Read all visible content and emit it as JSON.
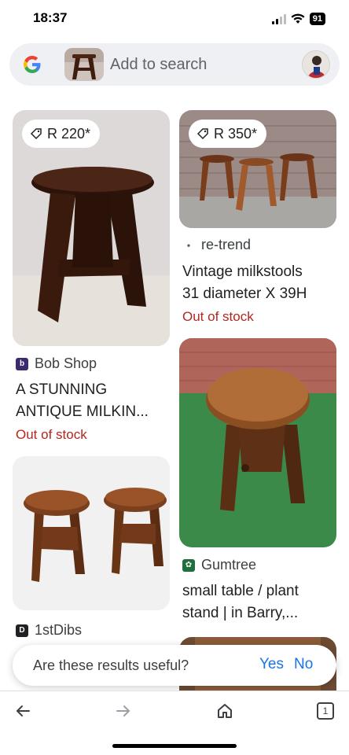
{
  "status_bar": {
    "time": "18:37",
    "battery": "91"
  },
  "search": {
    "placeholder": "Add to search"
  },
  "results": [
    {
      "price": "R 220*",
      "source": "Bob Shop",
      "title_line1": "A STUNNING",
      "title_line2": "ANTIQUE MILKIN...",
      "stock": "Out of stock"
    },
    {
      "price": "R 350*",
      "source": "re-trend",
      "title_line1": "Vintage milkstools",
      "title_line2": "31 diameter X 39H",
      "stock": "Out of stock"
    },
    {
      "source": "Gumtree",
      "title_line1": "small table / plant",
      "title_line2": "stand | in Barry,..."
    },
    {
      "source": "1stDibs"
    }
  ],
  "feedback": {
    "question": "Are these results useful?",
    "yes": "Yes",
    "no": "No"
  },
  "nav": {
    "tab_count": "1"
  },
  "colors": {
    "out_of_stock": "#b3261e",
    "link_blue": "#1a73e8",
    "search_bg": "#eef0f3"
  }
}
